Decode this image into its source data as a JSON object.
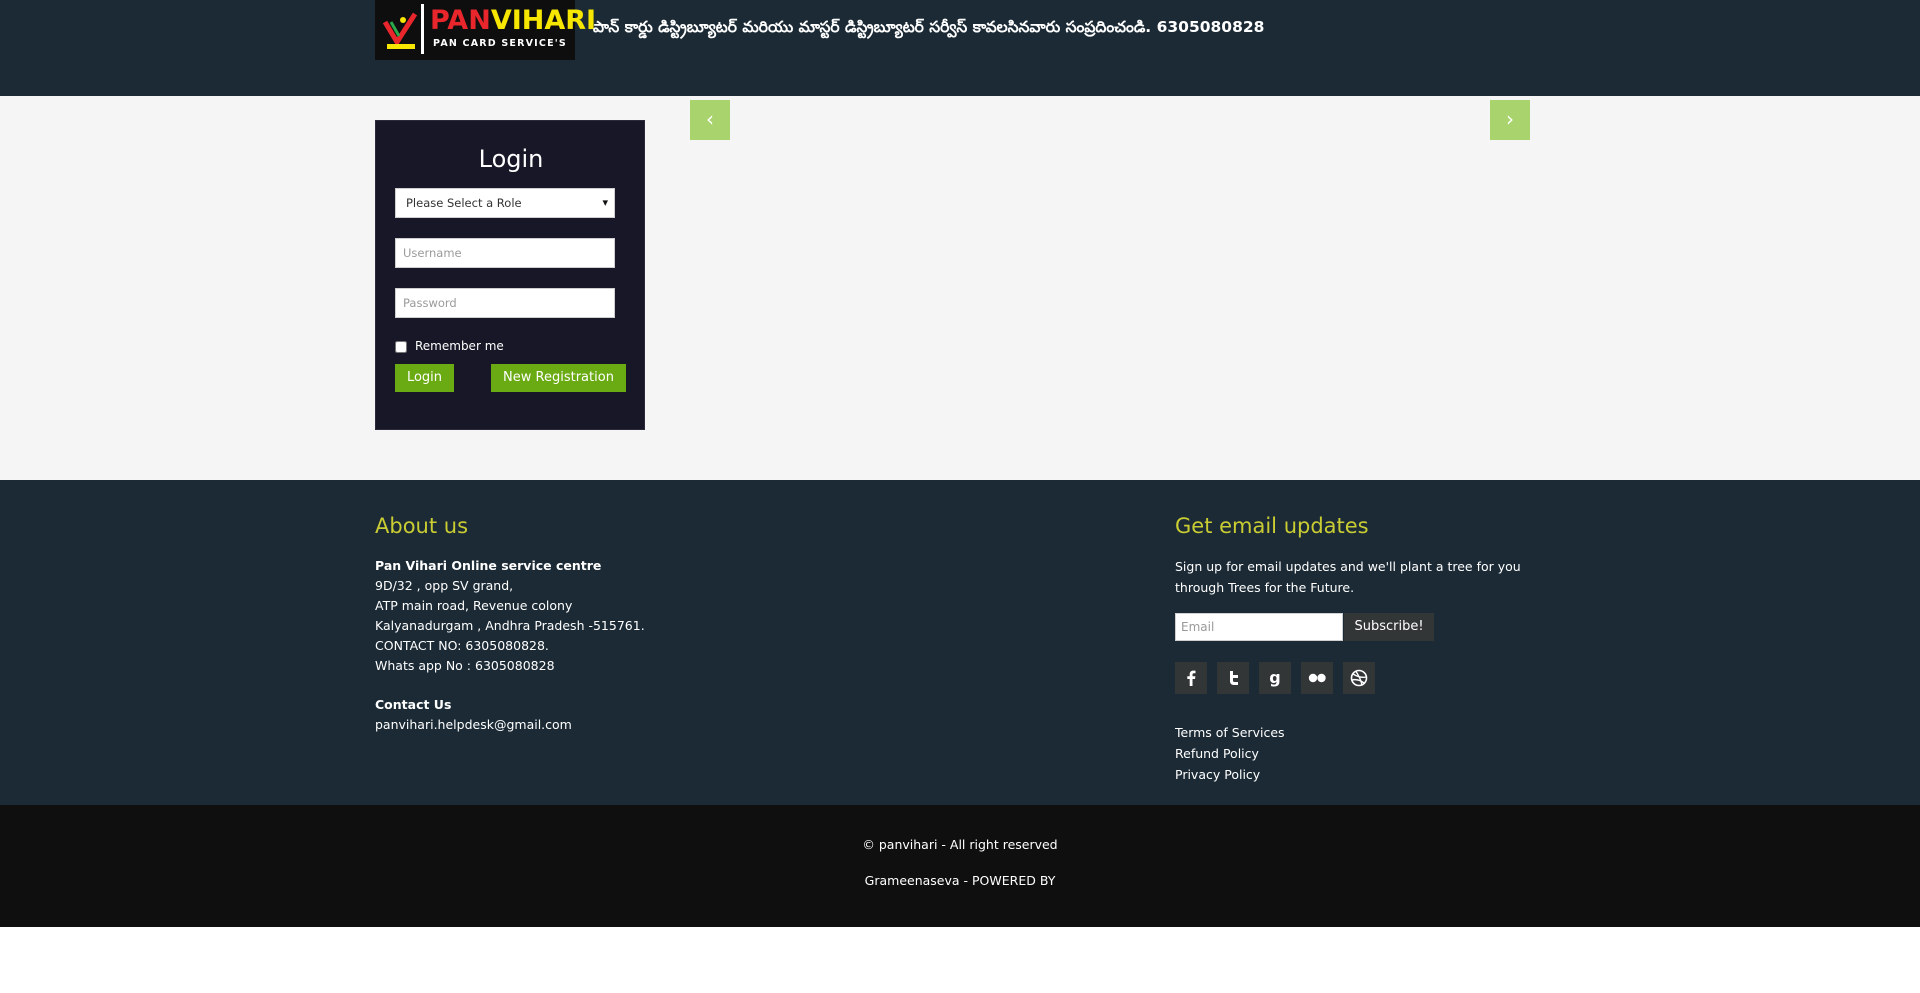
{
  "header": {
    "brand": {
      "pan": "PAN",
      "vihari": "VIHARI",
      "tagline": "PAN CARD SERVICE'S"
    },
    "marquee": "పాన్ కార్డు డిస్ట్రిబ్యూటర్ మరియు మాస్టర్ డిస్ట్రిబ్యూటర్ సర్వీస్ కావలసినవారు సంప్రదించండి. 6305080828"
  },
  "login": {
    "title": "Login",
    "role_select": "Please Select a Role",
    "username_placeholder": "Username",
    "password_placeholder": "Password",
    "remember_label": "Remember me",
    "login_button": "Login",
    "register_button": "New Registration"
  },
  "slider": {
    "prev": "‹",
    "next": "›"
  },
  "about": {
    "heading": "About us",
    "name": "Pan Vihari Online service centre",
    "lines": [
      "9D/32 , opp SV grand,",
      "ATP main road, Revenue colony",
      "Kalyanadurgam , Andhra Pradesh -515761.",
      "CONTACT NO: 6305080828.",
      "Whats app No : 6305080828"
    ],
    "contact_heading": "Contact Us",
    "contact_email": "panvihari.helpdesk@gmail.com"
  },
  "updates": {
    "heading": "Get email updates",
    "text": "Sign up for email updates and we'll plant a tree for you through Trees for the Future.",
    "email_placeholder": "Email",
    "subscribe_button": "Subscribe!"
  },
  "social": [
    "facebook-icon",
    "twitter-icon",
    "google-icon",
    "flickr-icon",
    "dribbble-icon"
  ],
  "policies": [
    "Terms of Services",
    "Refund Policy",
    "Privacy Policy"
  ],
  "bottom": {
    "copyright": "© panvihari - All right reserved",
    "powered": "Grameenaseva - POWERED BY"
  },
  "colors": {
    "header_bg": "#1b2a35",
    "accent_green": "#6aaa12",
    "heading_yellow": "#c9cc32",
    "slider_btn": "#a9d46d"
  }
}
